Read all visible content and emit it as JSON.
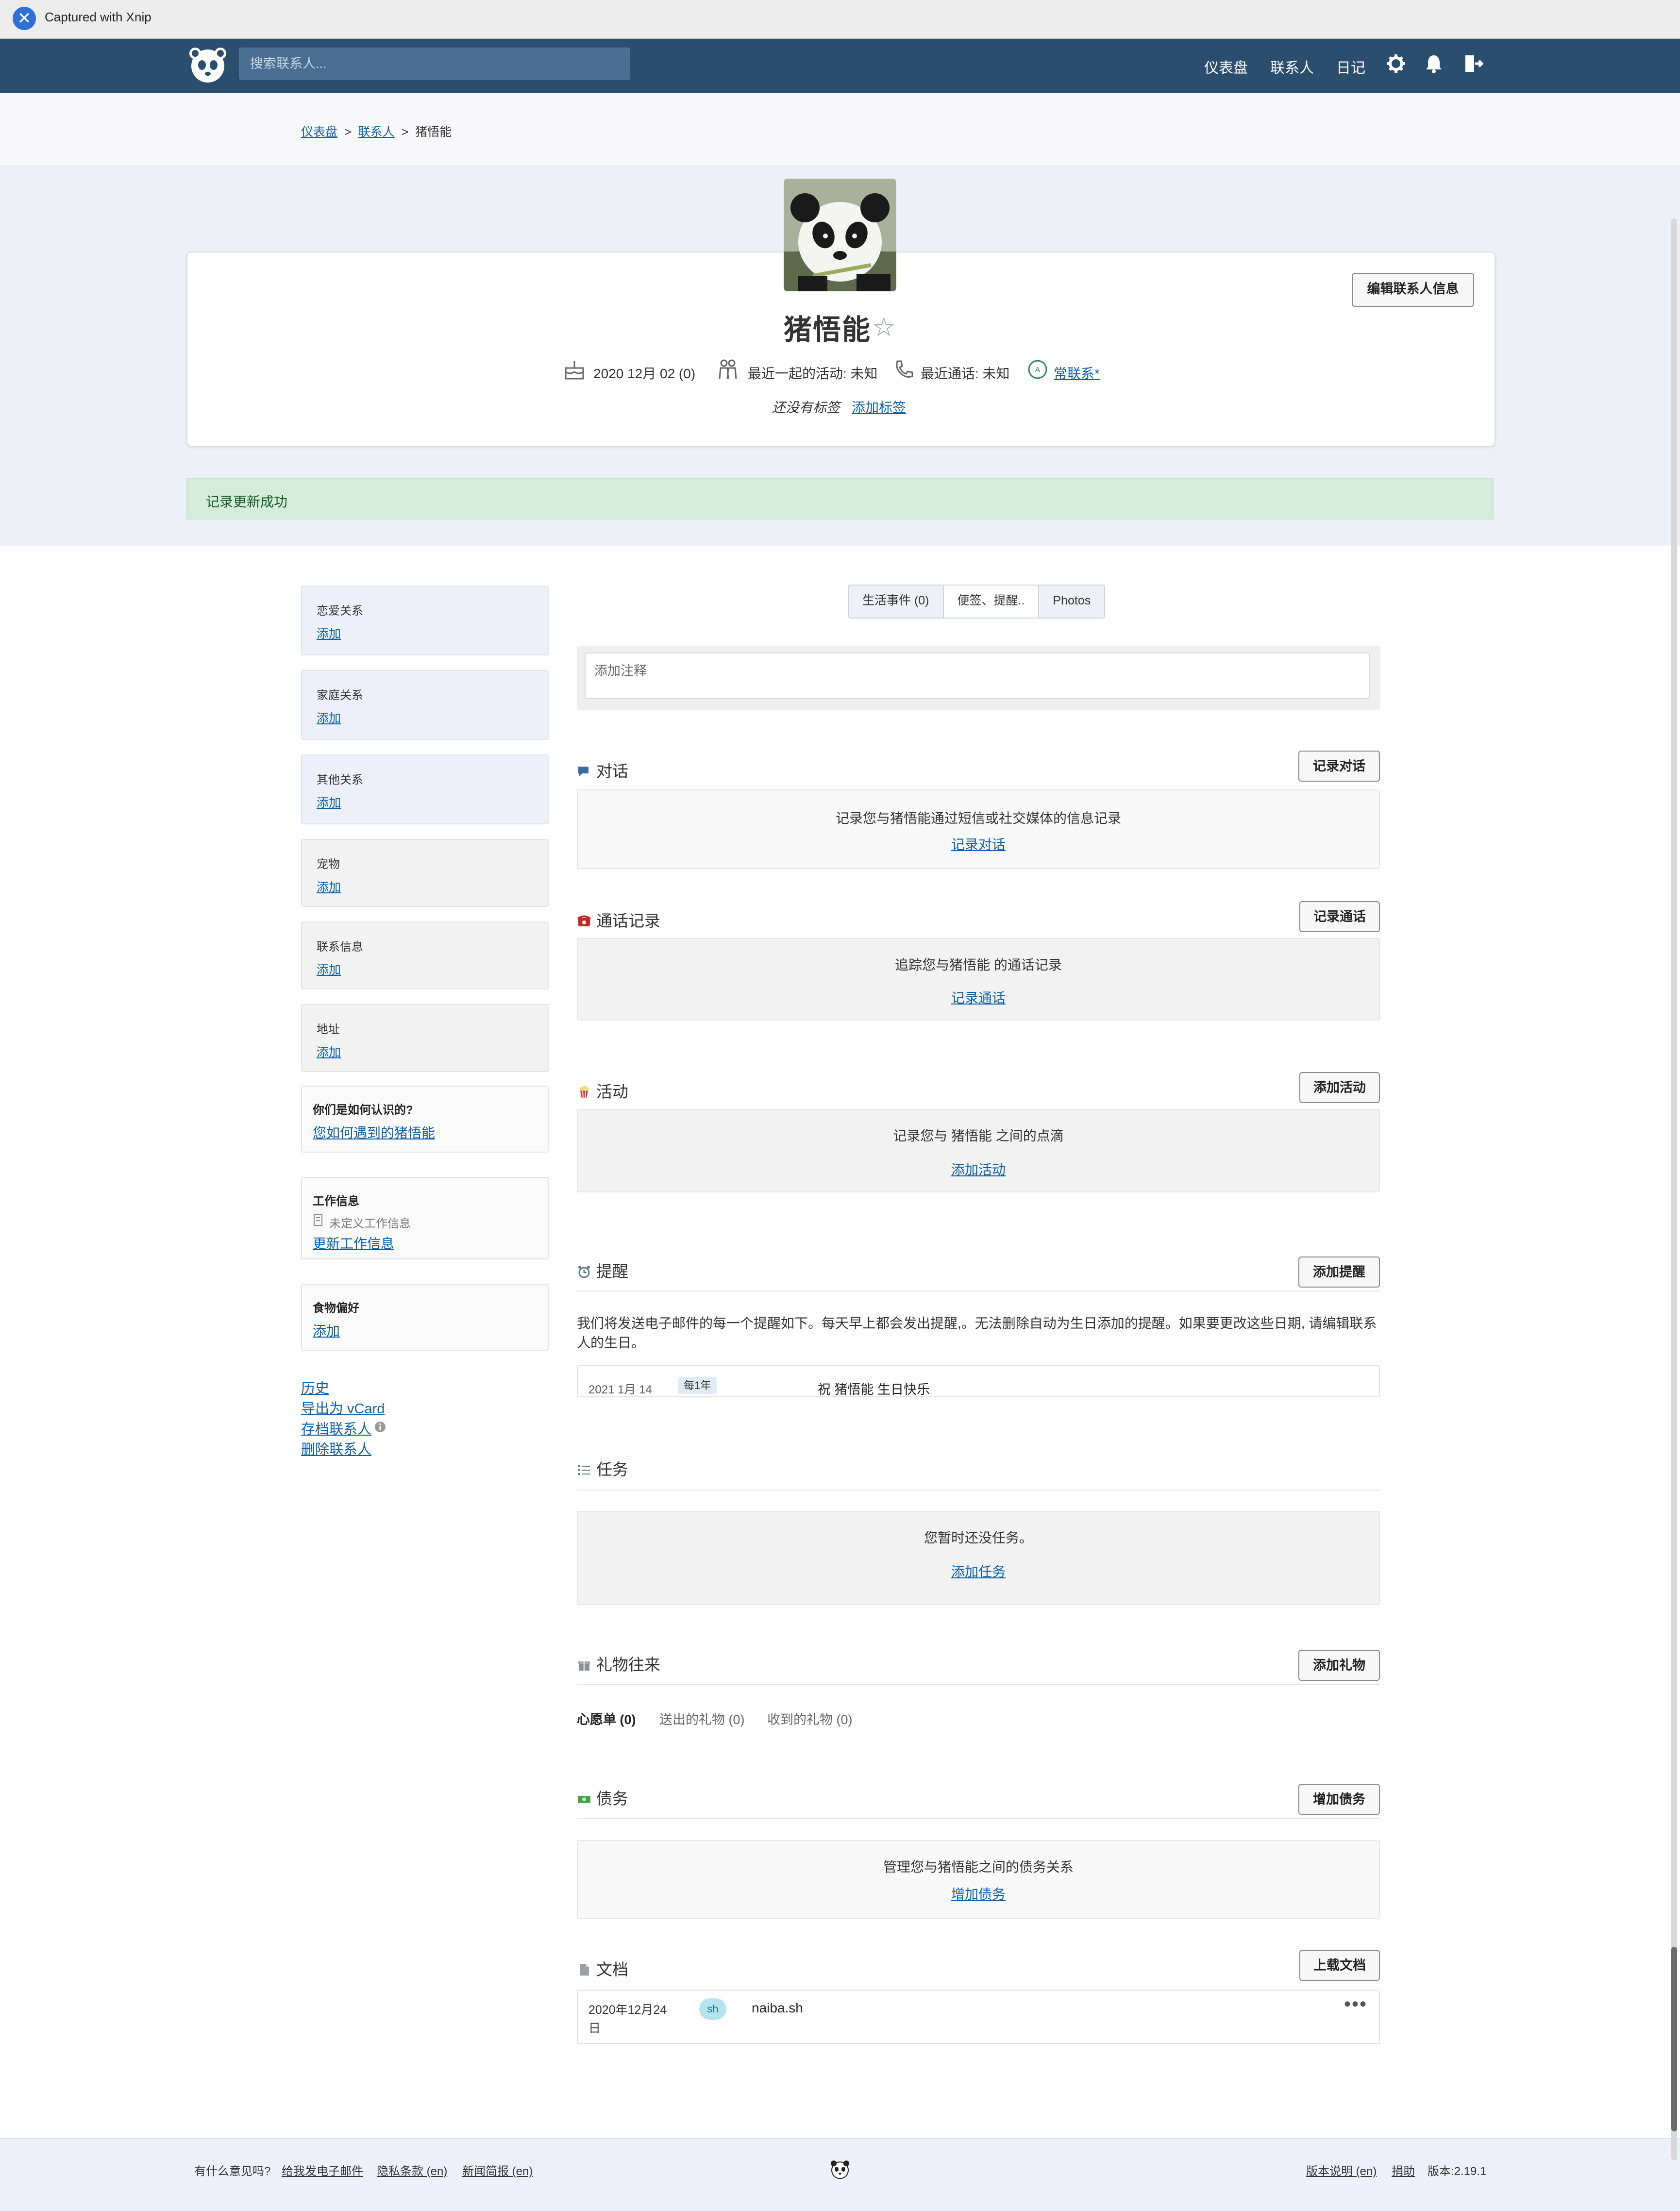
{
  "capture": {
    "title": "Captured with Xnip"
  },
  "nav": {
    "search_placeholder": "搜索联系人...",
    "links": [
      "仪表盘",
      "联系人",
      "日记"
    ]
  },
  "breadcrumb": {
    "home": "仪表盘",
    "contacts": "联系人",
    "current": "猪悟能"
  },
  "profile": {
    "name": "猪悟能",
    "edit_label": "编辑联系人信息",
    "birthday": "2020 12月 02 (0)",
    "last_activity": "最近一起的活动: 未知",
    "last_call": "最近通话: 未知",
    "frequency": "常联系*",
    "no_tags": "还没有标签",
    "add_tag": "添加标签"
  },
  "alert": {
    "message": "记录更新成功"
  },
  "sidebar": {
    "add_label": "添加",
    "sections": [
      "恋爱关系",
      "家庭关系",
      "其他关系",
      "宠物",
      "联系信息",
      "地址"
    ],
    "how_met": {
      "title": "你们是如何认识的?",
      "link": "您如何遇到的猪悟能"
    },
    "work": {
      "title": "工作信息",
      "undefined": "未定义工作信息",
      "link": "更新工作信息"
    },
    "food": {
      "title": "食物偏好",
      "link": "添加"
    },
    "links": {
      "history": "历史",
      "vcard": "导出为 vCard",
      "archive": "存档联系人",
      "delete": "删除联系人"
    }
  },
  "tabs": [
    "生活事件 (0)",
    "便签、提醒..",
    "Photos"
  ],
  "note": {
    "placeholder": "添加注释"
  },
  "conversations": {
    "title": "对话",
    "button": "记录对话",
    "empty": "记录您与猪悟能通过短信或社交媒体的信息记录",
    "link": "记录对话"
  },
  "calls": {
    "title": "通话记录",
    "button": "记录通话",
    "empty": "追踪您与猪悟能 的通话记录",
    "link": "记录通话"
  },
  "activities": {
    "title": "活动",
    "button": "添加活动",
    "empty": "记录您与 猪悟能 之间的点滴",
    "link": "添加活动"
  },
  "reminders": {
    "title": "提醒",
    "button": "添加提醒",
    "desc": "我们将发送电子邮件的每一个提醒如下。每天早上都会发出提醒,。无法删除自动为生日添加的提醒。如果要更改这些日期, 请编辑联系人的生日。",
    "item": {
      "date": "2021 1月 14",
      "freq": "每1年",
      "text": "祝 猪悟能 生日快乐"
    }
  },
  "tasks": {
    "title": "任务",
    "empty": "您暂时还没任务。",
    "link": "添加任务"
  },
  "gifts": {
    "title": "礼物往来",
    "button": "添加礼物",
    "tabs": [
      "心愿单 (0)",
      "送出的礼物 (0)",
      "收到的礼物 (0)"
    ]
  },
  "debts": {
    "title": "债务",
    "button": "增加债务",
    "empty": "管理您与猪悟能之间的债务关系",
    "link": "增加债务"
  },
  "documents": {
    "title": "文档",
    "button": "上载文档",
    "item": {
      "date_line1": "2020年12月24",
      "date_line2": "日",
      "ext": "sh",
      "name": "naiba.sh"
    }
  },
  "footer": {
    "question": "有什么意见吗?",
    "email": "给我发电子邮件",
    "privacy": "隐私条款 (en)",
    "newsletter": "新闻简报 (en)",
    "release": "版本说明 (en)",
    "donate": "捐助",
    "version": "版本:2.19.1"
  }
}
